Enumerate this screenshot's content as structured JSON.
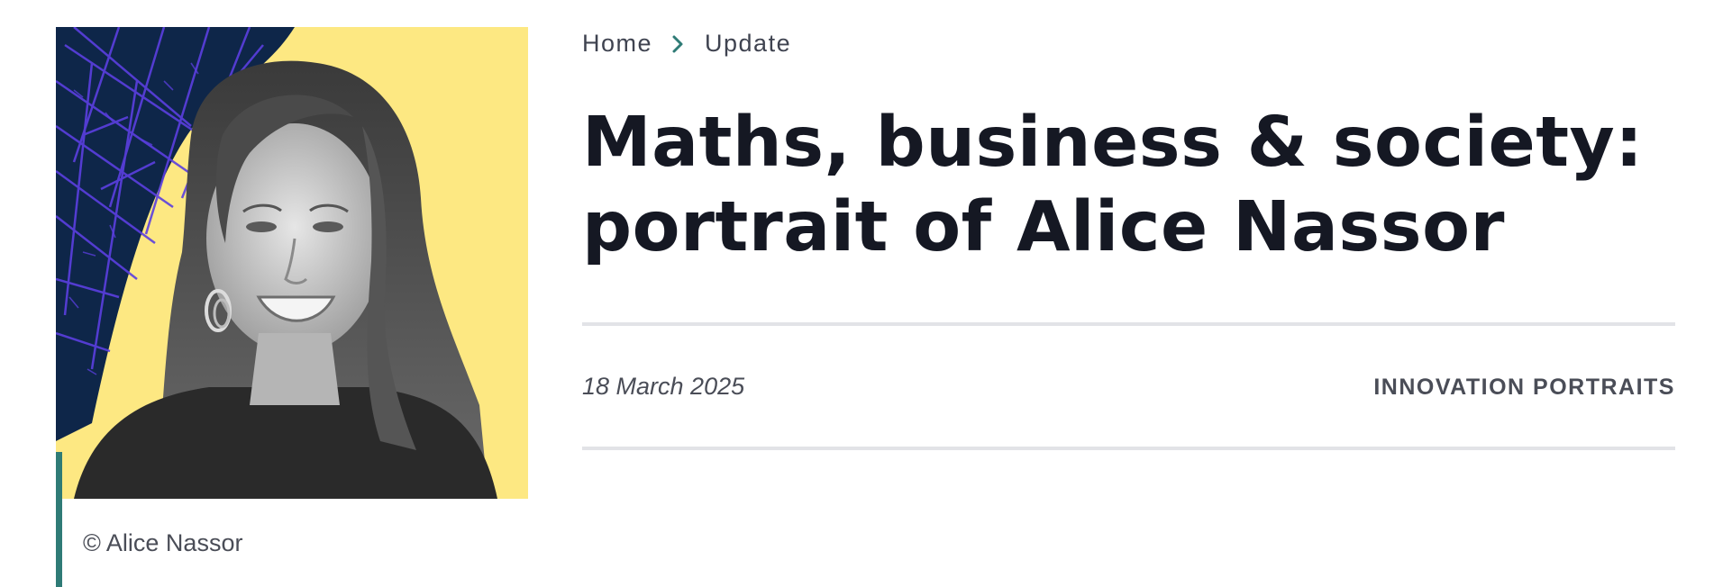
{
  "breadcrumb": {
    "items": [
      "Home",
      "Update"
    ],
    "separator_icon": "chevron-right-icon"
  },
  "article": {
    "title_line_1": "Maths, business & society:",
    "title_line_2": "portrait of Alice Nassor",
    "date": "18 March 2025",
    "category": "INNOVATION PORTRAITS"
  },
  "image": {
    "credit": "© Alice Nassor"
  },
  "colors": {
    "navy": "#0e2649",
    "yellow": "#fde882",
    "purple_lines": "#5b3fe0",
    "teal_accent": "#2f7b76",
    "chevron": "#2f7b76",
    "title": "#151823",
    "rule": "#e2e3e7"
  }
}
